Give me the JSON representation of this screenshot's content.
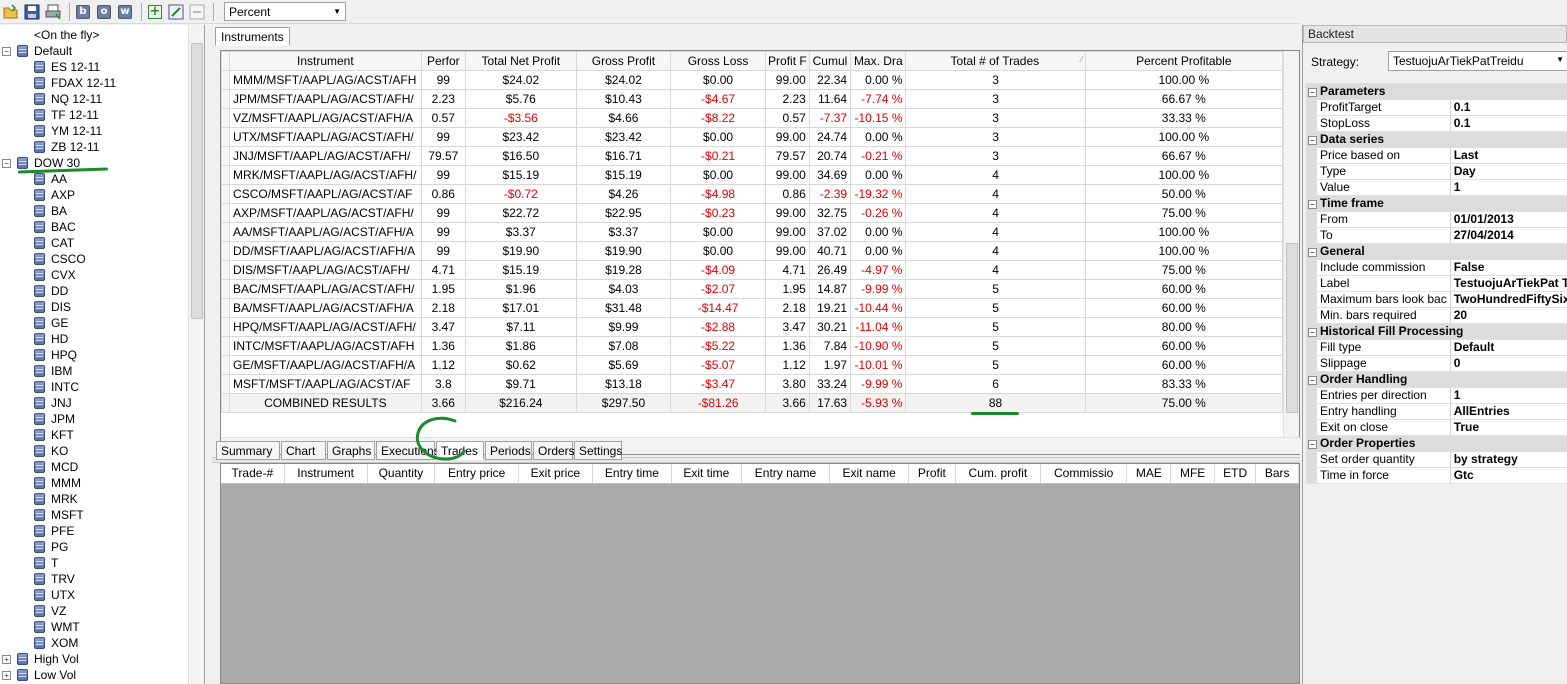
{
  "toolbar": {
    "buttons": [
      {
        "name": "open-icon"
      },
      {
        "name": "save-icon"
      },
      {
        "name": "print-icon"
      },
      {
        "name": "b-icon",
        "glyph": "b"
      },
      {
        "name": "o-icon",
        "glyph": "o"
      },
      {
        "name": "w-icon",
        "glyph": "w"
      },
      {
        "name": "add-icon"
      },
      {
        "name": "edit-icon"
      },
      {
        "name": "remove-icon"
      }
    ],
    "display_mode": "Percent"
  },
  "tree": {
    "items": [
      {
        "label": "<On the fly>",
        "level": 1,
        "expander": ""
      },
      {
        "label": "Default",
        "level": 0,
        "expander": "−"
      },
      {
        "label": "ES 12-11",
        "level": 1
      },
      {
        "label": "FDAX 12-11",
        "level": 1
      },
      {
        "label": "NQ 12-11",
        "level": 1
      },
      {
        "label": "TF 12-11",
        "level": 1
      },
      {
        "label": "YM 12-11",
        "level": 1
      },
      {
        "label": "ZB 12-11",
        "level": 1
      },
      {
        "label": "DOW 30",
        "level": 0,
        "expander": "−"
      },
      {
        "label": "AA",
        "level": 1
      },
      {
        "label": "AXP",
        "level": 1
      },
      {
        "label": "BA",
        "level": 1
      },
      {
        "label": "BAC",
        "level": 1
      },
      {
        "label": "CAT",
        "level": 1
      },
      {
        "label": "CSCO",
        "level": 1
      },
      {
        "label": "CVX",
        "level": 1
      },
      {
        "label": "DD",
        "level": 1
      },
      {
        "label": "DIS",
        "level": 1
      },
      {
        "label": "GE",
        "level": 1
      },
      {
        "label": "HD",
        "level": 1
      },
      {
        "label": "HPQ",
        "level": 1
      },
      {
        "label": "IBM",
        "level": 1
      },
      {
        "label": "INTC",
        "level": 1
      },
      {
        "label": "JNJ",
        "level": 1
      },
      {
        "label": "JPM",
        "level": 1
      },
      {
        "label": "KFT",
        "level": 1
      },
      {
        "label": "KO",
        "level": 1
      },
      {
        "label": "MCD",
        "level": 1
      },
      {
        "label": "MMM",
        "level": 1
      },
      {
        "label": "MRK",
        "level": 1
      },
      {
        "label": "MSFT",
        "level": 1
      },
      {
        "label": "PFE",
        "level": 1
      },
      {
        "label": "PG",
        "level": 1
      },
      {
        "label": "T",
        "level": 1
      },
      {
        "label": "TRV",
        "level": 1
      },
      {
        "label": "UTX",
        "level": 1
      },
      {
        "label": "VZ",
        "level": 1
      },
      {
        "label": "WMT",
        "level": 1
      },
      {
        "label": "XOM",
        "level": 1
      },
      {
        "label": "High Vol",
        "level": 0,
        "expander": "+"
      },
      {
        "label": "Low Vol",
        "level": 0,
        "expander": "+"
      }
    ]
  },
  "instruments_tab": "Instruments",
  "grid": {
    "columns": [
      "Instrument",
      "Perfor",
      "Total Net Profit",
      "Gross Profit",
      "Gross Loss",
      "Profit F",
      "Cumul",
      "Max. Dra",
      "Total # of Trades",
      "Percent Profitable"
    ],
    "sort_indicator": "⁄",
    "rows": [
      [
        "MMM/MSFT/AAPL/AG/ACST/AFH",
        "99",
        "$24.02",
        "$24.02",
        "$0.00",
        "99.00",
        "22.34",
        "0.00 %",
        "3",
        "100.00 %"
      ],
      [
        "JPM/MSFT/AAPL/AG/ACST/AFH/",
        "2.23",
        "$5.76",
        "$10.43",
        "-$4.67",
        "2.23",
        "11.64",
        "-7.74 %",
        "3",
        "66.67 %"
      ],
      [
        "VZ/MSFT/AAPL/AG/ACST/AFH/A",
        "0.57",
        "-$3.56",
        "$4.66",
        "-$8.22",
        "0.57",
        "-7.37",
        "-10.15 %",
        "3",
        "33.33 %"
      ],
      [
        "UTX/MSFT/AAPL/AG/ACST/AFH/",
        "99",
        "$23.42",
        "$23.42",
        "$0.00",
        "99.00",
        "24.74",
        "0.00 %",
        "3",
        "100.00 %"
      ],
      [
        "JNJ/MSFT/AAPL/AG/ACST/AFH/",
        "79.57",
        "$16.50",
        "$16.71",
        "-$0.21",
        "79.57",
        "20.74",
        "-0.21 %",
        "3",
        "66.67 %"
      ],
      [
        "MRK/MSFT/AAPL/AG/ACST/AFH/",
        "99",
        "$15.19",
        "$15.19",
        "$0.00",
        "99.00",
        "34.69",
        "0.00 %",
        "4",
        "100.00 %"
      ],
      [
        "CSCO/MSFT/AAPL/AG/ACST/AF",
        "0.86",
        "-$0.72",
        "$4.26",
        "-$4.98",
        "0.86",
        "-2.39",
        "-19.32 %",
        "4",
        "50.00 %"
      ],
      [
        "AXP/MSFT/AAPL/AG/ACST/AFH/",
        "99",
        "$22.72",
        "$22.95",
        "-$0.23",
        "99.00",
        "32.75",
        "-0.26 %",
        "4",
        "75.00 %"
      ],
      [
        "AA/MSFT/AAPL/AG/ACST/AFH/A",
        "99",
        "$3.37",
        "$3.37",
        "$0.00",
        "99.00",
        "37.02",
        "0.00 %",
        "4",
        "100.00 %"
      ],
      [
        "DD/MSFT/AAPL/AG/ACST/AFH/A",
        "99",
        "$19.90",
        "$19.90",
        "$0.00",
        "99.00",
        "40.71",
        "0.00 %",
        "4",
        "100.00 %"
      ],
      [
        "DIS/MSFT/AAPL/AG/ACST/AFH/",
        "4.71",
        "$15.19",
        "$19.28",
        "-$4.09",
        "4.71",
        "26.49",
        "-4.97 %",
        "4",
        "75.00 %"
      ],
      [
        "BAC/MSFT/AAPL/AG/ACST/AFH/",
        "1.95",
        "$1.96",
        "$4.03",
        "-$2.07",
        "1.95",
        "14.87",
        "-9.99 %",
        "5",
        "60.00 %"
      ],
      [
        "BA/MSFT/AAPL/AG/ACST/AFH/A",
        "2.18",
        "$17.01",
        "$31.48",
        "-$14.47",
        "2.18",
        "19.21",
        "-10.44 %",
        "5",
        "60.00 %"
      ],
      [
        "HPQ/MSFT/AAPL/AG/ACST/AFH/",
        "3.47",
        "$7.11",
        "$9.99",
        "-$2.88",
        "3.47",
        "30.21",
        "-11.04 %",
        "5",
        "80.00 %"
      ],
      [
        "INTC/MSFT/AAPL/AG/ACST/AFH",
        "1.36",
        "$1.86",
        "$7.08",
        "-$5.22",
        "1.36",
        "7.84",
        "-10.90 %",
        "5",
        "60.00 %"
      ],
      [
        "GE/MSFT/AAPL/AG/ACST/AFH/A",
        "1.12",
        "$0.62",
        "$5.69",
        "-$5.07",
        "1.12",
        "1.97",
        "-10.01 %",
        "5",
        "60.00 %"
      ],
      [
        "MSFT/MSFT/AAPL/AG/ACST/AF",
        "3.8",
        "$9.71",
        "$13.18",
        "-$3.47",
        "3.80",
        "33.24",
        "-9.99 %",
        "6",
        "83.33 %"
      ]
    ],
    "combined": [
      "COMBINED RESULTS",
      "3.66",
      "$216.24",
      "$297.50",
      "-$81.26",
      "3.66",
      "17.63",
      "-5.93 %",
      "88",
      "75.00 %"
    ]
  },
  "lower_tabs": [
    "Summary",
    "Chart",
    "Graphs",
    "Executions",
    "Trades",
    "Periods",
    "Orders",
    "Settings"
  ],
  "active_lower_tab": "Trades",
  "trades_columns": [
    "Trade-#",
    "Instrument",
    "Quantity",
    "Entry price",
    "Exit price",
    "Entry time",
    "Exit time",
    "Entry name",
    "Exit name",
    "Profit",
    "Cum. profit",
    "Commissio",
    "MAE",
    "MFE",
    "ETD",
    "Bars"
  ],
  "backtest": {
    "title": "Backtest",
    "strategy_label": "Strategy:",
    "strategy_value": "TestuojuArTiekPatTreidu",
    "categories": [
      {
        "name": "Parameters",
        "props": [
          [
            "ProfitTarget",
            "0.1"
          ],
          [
            "StopLoss",
            "0.1"
          ]
        ]
      },
      {
        "name": "Data series",
        "props": [
          [
            "Price based on",
            "Last"
          ],
          [
            "Type",
            "Day"
          ],
          [
            "Value",
            "1"
          ]
        ]
      },
      {
        "name": "Time frame",
        "props": [
          [
            "From",
            "01/01/2013"
          ],
          [
            "To",
            "27/04/2014"
          ]
        ]
      },
      {
        "name": "General",
        "props": [
          [
            "Include commission",
            "False"
          ],
          [
            "Label",
            "TestuojuArTiekPat Treidu"
          ],
          [
            "Maximum bars look bac",
            "TwoHundredFiftySix"
          ],
          [
            "Min. bars required",
            "20"
          ]
        ]
      },
      {
        "name": "Historical Fill Processing",
        "props": [
          [
            "Fill type",
            "Default"
          ],
          [
            "Slippage",
            "0"
          ]
        ]
      },
      {
        "name": "Order Handling",
        "props": [
          [
            "Entries per direction",
            "1"
          ],
          [
            "Entry handling",
            "AllEntries"
          ],
          [
            "Exit on close",
            "True"
          ]
        ]
      },
      {
        "name": "Order Properties",
        "props": [
          [
            "Set order quantity",
            "by strategy"
          ],
          [
            "Time in force",
            "Gtc"
          ]
        ]
      }
    ]
  },
  "colors": {
    "negative": "#e00000",
    "annotation": "#1a8a2a"
  }
}
